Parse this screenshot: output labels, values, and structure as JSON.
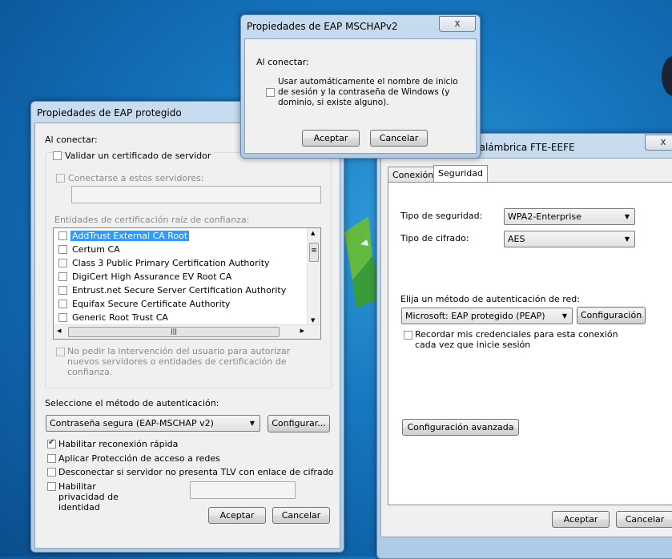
{
  "wifi_dialog": {
    "title": "nalámbrica FTE-EEFE",
    "tabs": [
      {
        "label": "Conexión"
      },
      {
        "label": "Seguridad"
      }
    ],
    "security_type_label": "Tipo de seguridad:",
    "security_type_value": "WPA2-Enterprise",
    "encryption_type_label": "Tipo de cifrado:",
    "encryption_type_value": "AES",
    "auth_method_label": "Elija un método de autenticación de red:",
    "auth_method_value": "Microsoft: EAP protegido (PEAP)",
    "config_button": "Configuración",
    "remember_credentials": "Recordar mis credenciales para esta conexión cada vez que inicie sesión",
    "advanced_button": "Configuración avanzada",
    "ok_button": "Aceptar",
    "cancel_button": "Cancelar",
    "close_glyph": "x"
  },
  "peap_dialog": {
    "title": "Propiedades de EAP protegido",
    "on_connect_label": "Al conectar:",
    "validate_cert": "Validar un certificado de servidor",
    "connect_servers": "Conectarse a estos servidores:",
    "servers_value": "",
    "trusted_roots_label": "Entidades de certificación raíz de confianza:",
    "cert_list": [
      {
        "label": "AddTrust External CA Root",
        "selected": true
      },
      {
        "label": "Certum CA",
        "selected": false
      },
      {
        "label": "Class 3 Public Primary Certification Authority",
        "selected": false
      },
      {
        "label": "DigiCert High Assurance EV Root CA",
        "selected": false
      },
      {
        "label": "Entrust.net Secure Server Certification Authority",
        "selected": false
      },
      {
        "label": "Equifax Secure Certificate Authority",
        "selected": false
      },
      {
        "label": "Generic Root Trust CA",
        "selected": false
      }
    ],
    "no_prompt": "No pedir la intervención del usuario para autorizar nuevos servidores o entidades de certificación de confianza.",
    "select_method_label": "Seleccione el método de autenticación:",
    "method_value": "Contraseña segura (EAP-MSCHAP v2)",
    "configure_button": "Configurar...",
    "options": [
      {
        "label": "Habilitar reconexión rápida",
        "checked": true
      },
      {
        "label": "Aplicar Protección de acceso a redes",
        "checked": false
      },
      {
        "label": "Desconectar si servidor no presenta TLV con enlace de cifrado",
        "checked": false
      }
    ],
    "privacy_label": "Habilitar privacidad de identidad",
    "privacy_value": "",
    "ok_button": "Aceptar",
    "cancel_button": "Cancelar"
  },
  "mschap_dialog": {
    "title": "Propiedades de EAP MSCHAPv2",
    "on_connect_label": "Al conectar:",
    "auto_login": "Usar automáticamente el nombre de inicio de sesión y la contraseña de Windows (y dominio, si existe alguno).",
    "ok_button": "Aceptar",
    "cancel_button": "Cancelar",
    "close_glyph": "x"
  },
  "colors": {
    "desktop": "#1677c0",
    "selection": "#3399ff",
    "dialog_face": "#f0f0f0"
  }
}
